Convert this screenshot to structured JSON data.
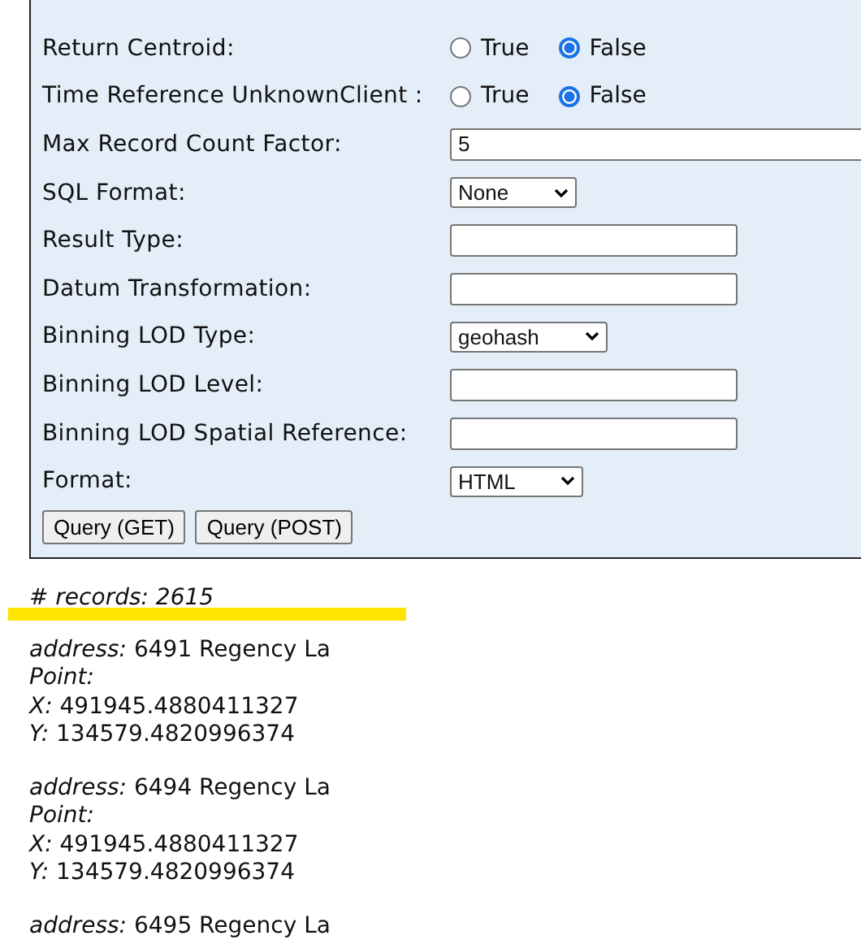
{
  "form": {
    "rows": [
      {
        "kind": "radio",
        "label": "Return Centroid:",
        "options": [
          {
            "label": "True",
            "selected": false
          },
          {
            "label": "False",
            "selected": true
          }
        ]
      },
      {
        "kind": "radio",
        "label": "Time Reference UnknownClient :",
        "options": [
          {
            "label": "True",
            "selected": false
          },
          {
            "label": "False",
            "selected": true
          }
        ]
      },
      {
        "kind": "wide-text",
        "label": "Max Record Count Factor:",
        "value": "5"
      },
      {
        "kind": "select",
        "label": "SQL Format:",
        "value": "None"
      },
      {
        "kind": "text",
        "label": "Result Type:"
      },
      {
        "kind": "text",
        "label": "Datum Transformation:"
      },
      {
        "kind": "select",
        "label": "Binning LOD Type:",
        "value": "geohash"
      },
      {
        "kind": "text",
        "label": "Binning LOD Level:"
      },
      {
        "kind": "text",
        "label": "Binning LOD Spatial Reference:"
      },
      {
        "kind": "select",
        "label": "Format:",
        "value": "HTML"
      }
    ],
    "buttons": [
      "Query (GET)",
      "Query (POST)"
    ]
  },
  "results": {
    "count": "# records: 2615",
    "records": [
      {
        "lines": [
          "*address:* 6491 Regency La",
          "*Point:*",
          "*X:* 491945.4880411327",
          "*Y:* 134579.4820996374"
        ]
      },
      {
        "lines": [
          "*address:* 6494 Regency La",
          "*Point:*",
          "*X:* 491945.4880411327",
          "*Y:* 134579.4820996374"
        ]
      },
      {
        "lines": [
          "*address:* 6495 Regency La"
        ]
      }
    ]
  }
}
